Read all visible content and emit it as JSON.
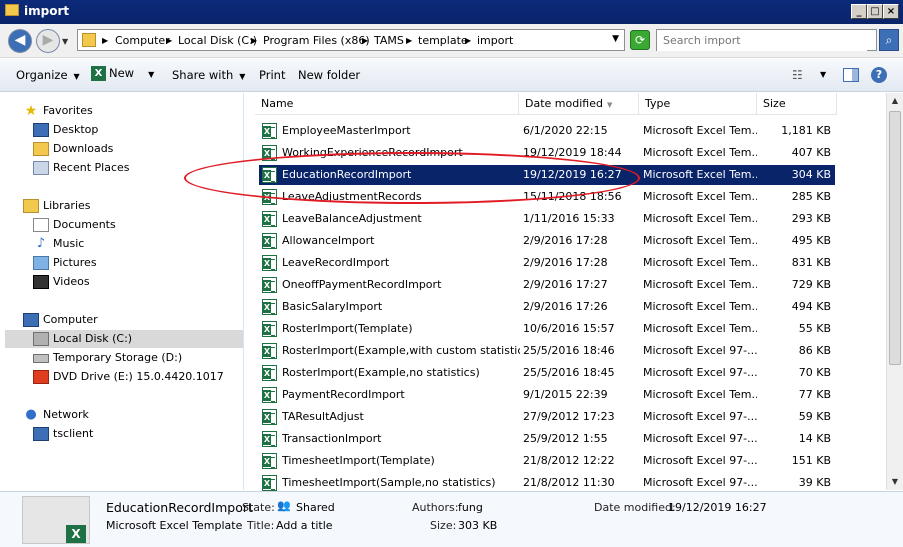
{
  "window": {
    "title": "import"
  },
  "address": {
    "crumbs": [
      "Computer",
      "Local Disk (C:)",
      "Program Files (x86)",
      "TAMS",
      "template",
      "import"
    ],
    "search_placeholder": "Search import"
  },
  "toolbar": {
    "organize": "Organize",
    "new": "New",
    "share_with": "Share with",
    "print": "Print",
    "new_folder": "New folder"
  },
  "nav": {
    "favorites": "Favorites",
    "desktop": "Desktop",
    "downloads": "Downloads",
    "recent_places": "Recent Places",
    "libraries": "Libraries",
    "documents": "Documents",
    "music": "Music",
    "pictures": "Pictures",
    "videos": "Videos",
    "computer": "Computer",
    "local_disk": "Local Disk (C:)",
    "temp_storage": "Temporary Storage (D:)",
    "dvd_drive": "DVD Drive (E:) 15.0.4420.1017",
    "network": "Network",
    "tsclient": "tsclient"
  },
  "columns": {
    "name": "Name",
    "date_modified": "Date modified",
    "type": "Type",
    "size": "Size"
  },
  "files": [
    {
      "name": "EmployeeMasterImport",
      "date": "6/1/2020 22:15",
      "type": "Microsoft Excel Tem...",
      "size": "1,181 KB"
    },
    {
      "name": "WorkingExperienceRecordImport",
      "date": "19/12/2019 18:44",
      "type": "Microsoft Excel Tem...",
      "size": "407 KB"
    },
    {
      "name": "EducationRecordImport",
      "date": "19/12/2019 16:27",
      "type": "Microsoft Excel Tem...",
      "size": "304 KB"
    },
    {
      "name": "LeaveAdjustmentRecords",
      "date": "15/11/2018 18:56",
      "type": "Microsoft Excel Tem...",
      "size": "285 KB"
    },
    {
      "name": "LeaveBalanceAdjustment",
      "date": "1/11/2016 15:33",
      "type": "Microsoft Excel Tem...",
      "size": "293 KB"
    },
    {
      "name": "AllowanceImport",
      "date": "2/9/2016 17:28",
      "type": "Microsoft Excel Tem...",
      "size": "495 KB"
    },
    {
      "name": "LeaveRecordImport",
      "date": "2/9/2016 17:28",
      "type": "Microsoft Excel Tem...",
      "size": "831 KB"
    },
    {
      "name": "OneoffPaymentRecordImport",
      "date": "2/9/2016 17:27",
      "type": "Microsoft Excel Tem...",
      "size": "729 KB"
    },
    {
      "name": "BasicSalaryImport",
      "date": "2/9/2016 17:26",
      "type": "Microsoft Excel Tem...",
      "size": "494 KB"
    },
    {
      "name": "RosterImport(Template)",
      "date": "10/6/2016 15:57",
      "type": "Microsoft Excel Tem...",
      "size": "55 KB"
    },
    {
      "name": "RosterImport(Example,with custom statistics)",
      "date": "25/5/2016 18:46",
      "type": "Microsoft Excel 97-...",
      "size": "86 KB"
    },
    {
      "name": "RosterImport(Example,no statistics)",
      "date": "25/5/2016 18:45",
      "type": "Microsoft Excel 97-...",
      "size": "70 KB"
    },
    {
      "name": "PaymentRecordImport",
      "date": "9/1/2015 22:39",
      "type": "Microsoft Excel Tem...",
      "size": "77 KB"
    },
    {
      "name": "TAResultAdjust",
      "date": "27/9/2012 17:23",
      "type": "Microsoft Excel 97-...",
      "size": "59 KB"
    },
    {
      "name": "TransactionImport",
      "date": "25/9/2012 1:55",
      "type": "Microsoft Excel 97-...",
      "size": "14 KB"
    },
    {
      "name": "TimesheetImport(Template)",
      "date": "21/8/2012 12:22",
      "type": "Microsoft Excel 97-...",
      "size": "151 KB"
    },
    {
      "name": "TimesheetImport(Sample,no statistics)",
      "date": "21/8/2012 11:30",
      "type": "Microsoft Excel 97-...",
      "size": "39 KB"
    }
  ],
  "details": {
    "file_name": "EducationRecordImport",
    "file_type": "Microsoft Excel Template",
    "state_label": "State:",
    "state_value": "Shared",
    "title_label": "Title:",
    "title_value": "Add a title",
    "authors_label": "Authors:",
    "authors_value": "fung",
    "size_label": "Size:",
    "size_value": "303 KB",
    "date_label": "Date modified:",
    "date_value": "19/12/2019 16:27"
  }
}
